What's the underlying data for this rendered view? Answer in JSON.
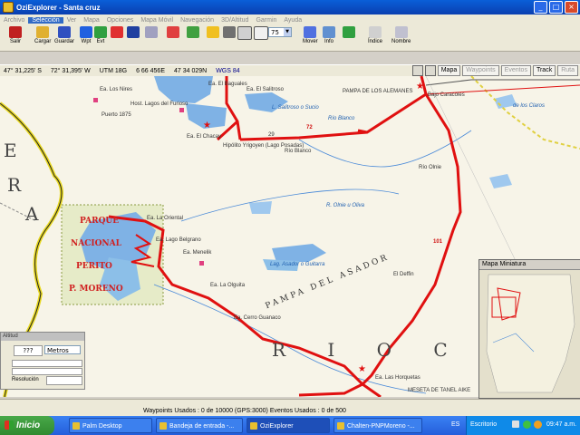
{
  "window": {
    "title": "OziExplorer - Santa cruz"
  },
  "menu": [
    "Archivo",
    "Selección",
    "Ver",
    "Mapa",
    "Opciones",
    "Mapa Móvil",
    "Navegación",
    "3D/Altitud",
    "Garmin",
    "Ayuda"
  ],
  "toolbar": {
    "salir": "Salir",
    "cargar": "Cargar",
    "guardar": "Guardar",
    "wpt": "Wpt",
    "evt": "Evt",
    "zoom": "75",
    "mover": "Mover",
    "info": "Info",
    "indice": "Índice",
    "nombre": "Nombre"
  },
  "coords": {
    "lat": "47° 31,225' S",
    "lon": "72° 31,395' W",
    "utm": "UTM 18G",
    "easting": "6 66 456E",
    "northing": "47 34 029N",
    "datum": "WGS 84"
  },
  "maptabs": [
    "Mapa",
    "Waypoints",
    "Eventos",
    "Track",
    "Ruta"
  ],
  "labels": {
    "los_nires": "Ea. Los Nires",
    "puerto": "Puerto 1875",
    "hosteria": "Host. Lagos del Furioso",
    "baguales": "Ea. El Baguales",
    "el_salitroso": "Ea. El Salitroso",
    "lago_sucio": "L. Salitroso o Sucio",
    "pampa": "PAMPA DE LOS ALEMANES",
    "rio_blanco": "Río Blanco",
    "bajo_caracoles": "Bajo Caracoles",
    "los_claros": "de los Claros",
    "chacay": "Ea. El Chacay",
    "hipolito": "Hipólito Yrigoyen (Lago Posadas)",
    "rio_olnie": "Río Olnie",
    "ruta29": "29",
    "km72": "72",
    "km101": "101",
    "la_oriental": "Ea. La Oriental",
    "lago_belgrano": "Ea. Lago Belgrano",
    "menelik": "Ea. Menelik",
    "olnie_oliva": "R. Olnie u Oliva",
    "lago_asador": "Lag. Asador o Guitarra",
    "pampa_asador": "PAMPA DEL ASADOR",
    "el_deffin": "El Deffin",
    "la_olguita": "Ea. La Olguita",
    "cerro_guanaco": "Ea. Cerro Guanaco",
    "tres_lagos": "Ea. Las Horquetas",
    "meseta": "MESETA DE TANEL AIKE",
    "parque": "PARQUE",
    "nacional": "NACIONAL",
    "perito": "PERITO",
    "moreno": "P. MORENO",
    "chile": "R",
    "letter_a": "A",
    "letter_e": "E",
    "rio_chico": "R I O   C H"
  },
  "altitude": {
    "title": "Altitud",
    "value": "???",
    "unit": "Metros",
    "resolucion": "Resolución"
  },
  "minimap": {
    "title": "Mapa Miniatura"
  },
  "status": {
    "text": "Waypoints Usados : 0 de 10000  (GPS:3000)  Eventos Usados : 0 de 500"
  },
  "taskbar": {
    "start": "Inicio",
    "tasks": [
      "Palm Desktop",
      "Bandeja de entrada -...",
      "OziExplorer",
      "Chalten-PNPMoreno -..."
    ],
    "lang": "ES",
    "desktop": "Escritorio",
    "time": "09:47 a.m."
  }
}
